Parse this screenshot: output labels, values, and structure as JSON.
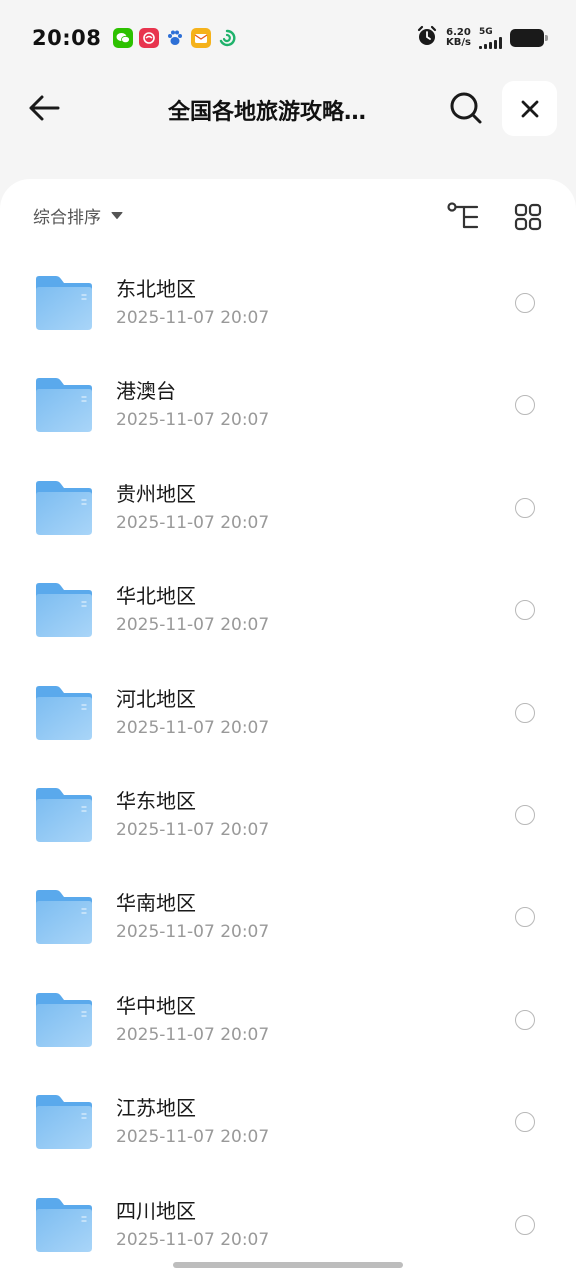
{
  "status_bar": {
    "time": "20:08",
    "net_speed_value": "6.20",
    "net_speed_unit": "KB/s",
    "network_type": "5G",
    "notification_icons": [
      "wechat-icon",
      "mail-app-icon",
      "baidu-paw-icon",
      "message-icon",
      "green-swirl-icon"
    ]
  },
  "header": {
    "title": "全国各地旅游攻略…"
  },
  "toolbar": {
    "sort_label": "综合排序"
  },
  "files": [
    {
      "name": "东北地区",
      "date": "2025-11-07 20:07"
    },
    {
      "name": "港澳台",
      "date": "2025-11-07 20:07"
    },
    {
      "name": "贵州地区",
      "date": "2025-11-07 20:07"
    },
    {
      "name": "华北地区",
      "date": "2025-11-07 20:07"
    },
    {
      "name": "河北地区",
      "date": "2025-11-07 20:07"
    },
    {
      "name": "华东地区",
      "date": "2025-11-07 20:07"
    },
    {
      "name": "华南地区",
      "date": "2025-11-07 20:07"
    },
    {
      "name": "华中地区",
      "date": "2025-11-07 20:07"
    },
    {
      "name": "江苏地区",
      "date": "2025-11-07 20:07"
    },
    {
      "name": "四川地区",
      "date": "2025-11-07 20:07"
    }
  ],
  "colors": {
    "background": "#f5f5f5",
    "card": "#ffffff",
    "folder_front": "#86c2f2",
    "folder_back": "#5aa9ec",
    "date_text": "#999999"
  }
}
